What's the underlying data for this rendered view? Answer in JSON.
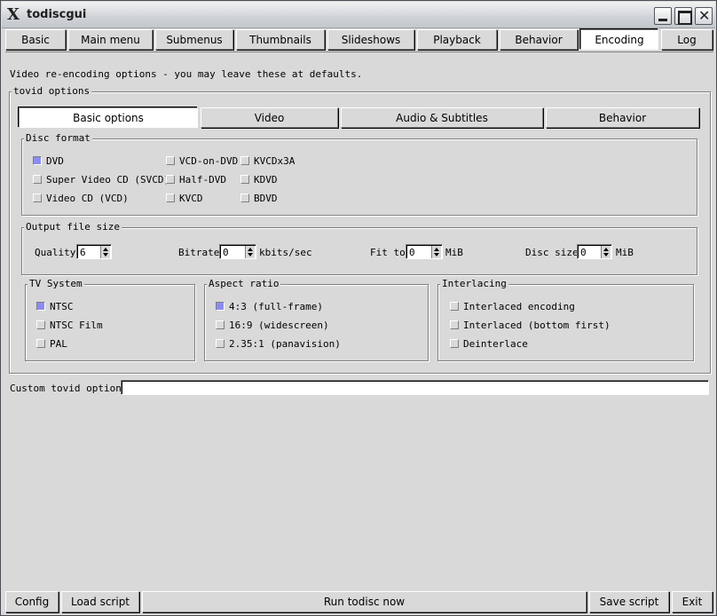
{
  "window": {
    "title": "todiscgui",
    "app_icon": "X"
  },
  "main_tabs": [
    "Basic",
    "Main menu",
    "Submenus",
    "Thumbnails",
    "Slideshows",
    "Playback",
    "Behavior",
    "Encoding",
    "Log"
  ],
  "active_main_tab": "Encoding",
  "intro": "Video re-encoding options - you may leave these at defaults.",
  "tovid": {
    "legend": "tovid options",
    "subtabs": [
      "Basic options",
      "Video",
      "Audio & Subtitles",
      "Behavior"
    ],
    "active_subtab": "Basic options",
    "disc_format": {
      "legend": "Disc format",
      "options": [
        "DVD",
        "Super Video CD (SVCD)",
        "Video CD (VCD)",
        "VCD-on-DVD",
        "Half-DVD",
        "KVCD",
        "KVCDx3A",
        "KDVD",
        "BDVD"
      ],
      "selected": "DVD"
    },
    "output_size": {
      "legend": "Output file size",
      "quality_label": "Quality",
      "quality_value": "6",
      "bitrate_label": "Bitrate",
      "bitrate_value": "0",
      "bitrate_unit": "kbits/sec",
      "fit_label": "Fit to",
      "fit_value": "0",
      "fit_unit": "MiB",
      "disc_label": "Disc size",
      "disc_value": "0",
      "disc_unit": "MiB"
    },
    "tv_system": {
      "legend": "TV System",
      "options": [
        "NTSC",
        "NTSC Film",
        "PAL"
      ],
      "selected": "NTSC"
    },
    "aspect": {
      "legend": "Aspect ratio",
      "options": [
        "4:3 (full-frame)",
        "16:9 (widescreen)",
        "2.35:1 (panavision)"
      ],
      "selected": "4:3 (full-frame)"
    },
    "interlacing": {
      "legend": "Interlacing",
      "options": [
        "Interlaced encoding",
        "Interlaced (bottom first)",
        "Deinterlace"
      ],
      "selected": ""
    }
  },
  "custom": {
    "label": "Custom tovid options",
    "value": ""
  },
  "bottom": {
    "config": "Config",
    "load": "Load script",
    "run": "Run todisc now",
    "save": "Save script",
    "exit": "Exit"
  },
  "colors": {
    "radio_selected": "#8c8cf0",
    "background": "#d9d9d9"
  }
}
